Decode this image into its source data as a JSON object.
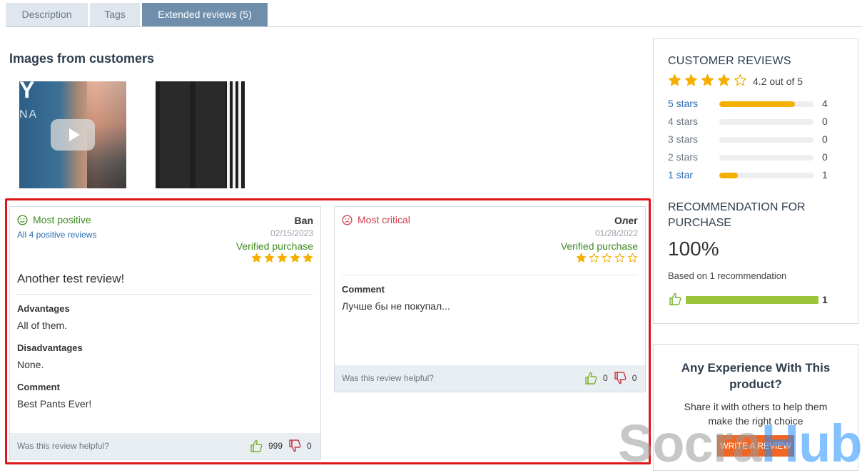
{
  "tabs": [
    {
      "label": "Description"
    },
    {
      "label": "Tags"
    },
    {
      "label": "Extended reviews (5)"
    }
  ],
  "images_section": {
    "title": "Images from customers",
    "video_overlay_text_1": "Y",
    "video_overlay_text_2": "NA"
  },
  "reviews": {
    "positive": {
      "kind_label": "Most positive",
      "all_link": "All 4 positive reviews",
      "author": "Ban",
      "date": "02/15/2023",
      "verified": "Verified purchase",
      "rating": 5,
      "headline": "Another test review!",
      "advantages_label": "Advantages",
      "advantages": "All of them.",
      "disadvantages_label": "Disadvantages",
      "disadvantages": "None.",
      "comment_label": "Comment",
      "comment": "Best Pants Ever!",
      "helpful_label": "Was this review helpful?",
      "likes": "999",
      "dislikes": "0"
    },
    "critical": {
      "kind_label": "Most critical",
      "author": "Олег",
      "date": "01/28/2022",
      "verified": "Verified purchase",
      "rating": 1,
      "comment_label": "Comment",
      "comment": "Лучше бы не покупал...",
      "helpful_label": "Was this review helpful?",
      "likes": "0",
      "dislikes": "0"
    }
  },
  "customer_reviews": {
    "title": "CUSTOMER REVIEWS",
    "rating": 4.2,
    "out_of": "4.2 out of 5",
    "histogram": [
      {
        "label": "5 stars",
        "count": "4",
        "fraction": 0.8,
        "link": true
      },
      {
        "label": "4 stars",
        "count": "0",
        "fraction": 0,
        "link": false
      },
      {
        "label": "3 stars",
        "count": "0",
        "fraction": 0,
        "link": false
      },
      {
        "label": "2 stars",
        "count": "0",
        "fraction": 0,
        "link": false
      },
      {
        "label": "1 star",
        "count": "1",
        "fraction": 0.2,
        "link": true
      }
    ]
  },
  "recommendation": {
    "title": "RECOMMENDATION FOR PURCHASE",
    "percent": "100%",
    "based_on": "Based on 1 recommendation",
    "count": "1",
    "fraction": 1.0
  },
  "experience": {
    "title": "Any Experience With This product?",
    "text": "Share it with others to help them make the right choice",
    "button": "WRITE A REVIEW"
  },
  "watermark": {
    "part1": "Socra",
    "part2": "Hub"
  },
  "colors": {
    "star": "#f4b000",
    "positive": "#3d8b1f",
    "critical": "#d33d4d",
    "link": "#2b6cb0",
    "highlight": "#e1141b",
    "tab_active": "#6f8eac",
    "recommend_bar": "#9bc53d",
    "button": "#f26522"
  },
  "icons": [
    "smile-icon",
    "frown-icon",
    "star-icon",
    "thumbs-up-icon",
    "thumbs-down-icon",
    "play-icon"
  ]
}
